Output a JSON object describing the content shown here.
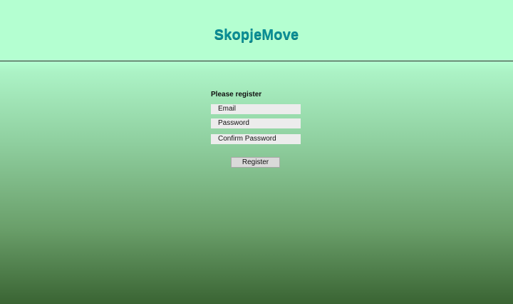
{
  "header": {
    "logo_text": "SkopjeMove"
  },
  "register_form": {
    "title": "Please register",
    "email_placeholder": "Email",
    "password_placeholder": "Password",
    "confirm_password_placeholder": "Confirm Password",
    "submit_label": "Register"
  },
  "colors": {
    "header_background": "#b4ffd1",
    "logo": "#0b8f96",
    "gradient_bottom": "#3a6433"
  }
}
